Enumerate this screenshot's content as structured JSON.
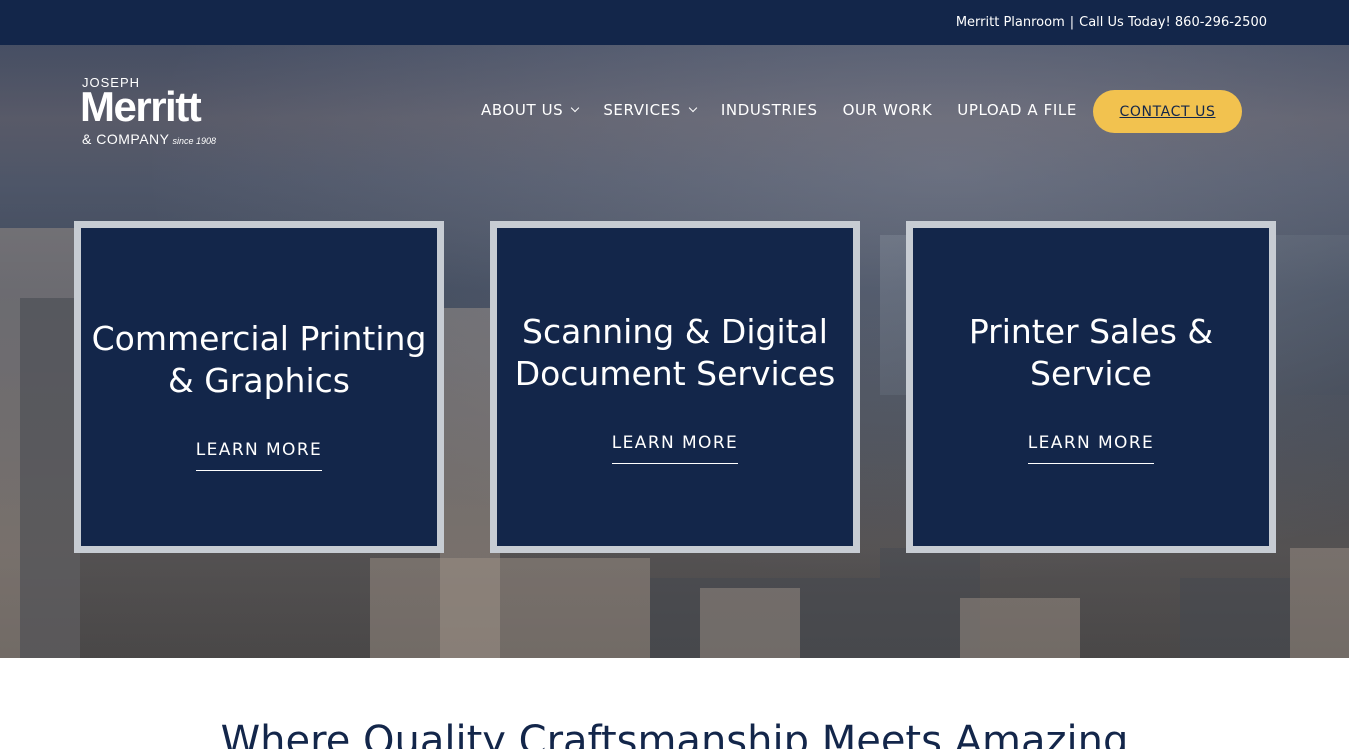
{
  "topbar": {
    "planroom": "Merritt Planroom",
    "separator": "|",
    "phone": "Call Us Today! 860-296-2500"
  },
  "logo": {
    "line1": "JOSEPH",
    "line2": "Merritt",
    "line3": "& COMPANY",
    "since": "since 1908"
  },
  "nav": {
    "items": [
      {
        "label": "ABOUT US",
        "dropdown": true
      },
      {
        "label": "SERVICES",
        "dropdown": true
      },
      {
        "label": "INDUSTRIES",
        "dropdown": false
      },
      {
        "label": "OUR WORK",
        "dropdown": false
      },
      {
        "label": "UPLOAD A FILE",
        "dropdown": false
      }
    ],
    "contact": "CONTACT US"
  },
  "cards": [
    {
      "title": "Commercial Printing & Graphics",
      "link": "LEARN MORE"
    },
    {
      "title": "Scanning & Digital Document Services",
      "link": "LEARN MORE"
    },
    {
      "title": "Printer Sales & Service",
      "link": "LEARN MORE"
    }
  ],
  "tagline": "Where Quality Craftsmanship Meets Amazing",
  "colors": {
    "navy": "#13264a",
    "accent": "#f2c24f",
    "white": "#ffffff"
  }
}
